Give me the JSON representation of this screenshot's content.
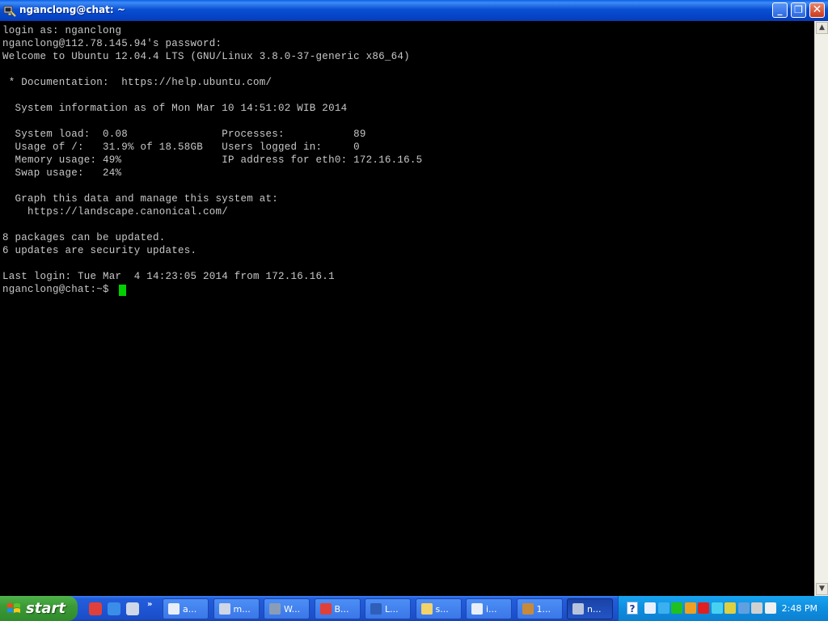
{
  "window": {
    "title": "nganclong@chat: ~",
    "min_glyph": "_",
    "max_glyph": "❐",
    "close_glyph": "✕"
  },
  "terminal": {
    "lines": [
      "login as: nganclong",
      "nganclong@112.78.145.94's password:",
      "Welcome to Ubuntu 12.04.4 LTS (GNU/Linux 3.8.0-37-generic x86_64)",
      "",
      " * Documentation:  https://help.ubuntu.com/",
      "",
      "  System information as of Mon Mar 10 14:51:02 WIB 2014",
      "",
      "  System load:  0.08               Processes:           89",
      "  Usage of /:   31.9% of 18.58GB   Users logged in:     0",
      "  Memory usage: 49%                IP address for eth0: 172.16.16.5",
      "  Swap usage:   24%",
      "",
      "  Graph this data and manage this system at:",
      "    https://landscape.canonical.com/",
      "",
      "8 packages can be updated.",
      "6 updates are security updates.",
      "",
      "Last login: Tue Mar  4 14:23:05 2014 from 172.16.16.1",
      "nganclong@chat:~$ "
    ],
    "text_color": "#c8c8c8",
    "cursor_color": "#00d000"
  },
  "scrollbar": {
    "up_glyph": "▲",
    "down_glyph": "▼"
  },
  "taskbar": {
    "start_label": "start",
    "quicklaunch_chevron": "»",
    "quicklaunch": [
      {
        "icon": "chrome-icon",
        "color": "#e0403a"
      },
      {
        "icon": "ie-icon",
        "color": "#3a8ee8"
      },
      {
        "icon": "virtualbox-icon",
        "color": "#cfd8e8"
      }
    ],
    "tasks": [
      {
        "icon": "document-icon",
        "label": "a...",
        "color": "#e8eef8",
        "active": false
      },
      {
        "icon": "messenger-icon",
        "label": "m...",
        "color": "#cfd6e6",
        "active": false
      },
      {
        "icon": "terminal-icon",
        "label": "W...",
        "color": "#8a9db8",
        "active": false
      },
      {
        "icon": "chrome-icon",
        "label": "B...",
        "color": "#e0403a",
        "active": false
      },
      {
        "icon": "word-icon",
        "label": "L...",
        "color": "#2f5fb8",
        "active": false
      },
      {
        "icon": "folder-icon",
        "label": "s...",
        "color": "#f2d26a",
        "active": false
      },
      {
        "icon": "document-icon",
        "label": "i...",
        "color": "#e8eef8",
        "active": false
      },
      {
        "icon": "app-icon",
        "label": "1...",
        "color": "#c78a3a",
        "active": false
      },
      {
        "icon": "putty-icon",
        "label": "n...",
        "color": "#b8c4dc",
        "active": true
      }
    ],
    "tray": {
      "help_glyph": "?",
      "icons": [
        {
          "icon": "network-icon",
          "color": "#e8f0ff"
        },
        {
          "icon": "back-icon",
          "color": "#3ab0f0"
        },
        {
          "icon": "green-square-icon",
          "color": "#20c020"
        },
        {
          "icon": "flame-icon",
          "color": "#f0a020"
        },
        {
          "icon": "antivirus-icon",
          "color": "#e02020"
        },
        {
          "icon": "windows-icon",
          "color": "#48d0f0"
        },
        {
          "icon": "update-icon",
          "color": "#e0d040"
        },
        {
          "icon": "monitor-icon",
          "color": "#60a0e0"
        },
        {
          "icon": "weather-icon",
          "color": "#d0d0d0"
        },
        {
          "icon": "vmware-icon",
          "color": "#f0f0f0"
        }
      ],
      "clock": "2:48 PM"
    }
  }
}
